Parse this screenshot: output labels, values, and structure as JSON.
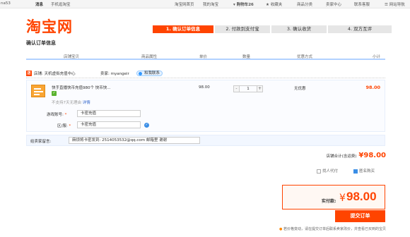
{
  "topbar": {
    "user": "na53",
    "messages": "消息",
    "mobile": "手机逛淘宝",
    "home": "淘宝网首页",
    "my_taobao": "我的淘宝",
    "cart": "购物车",
    "cart_count": "26",
    "favorites": "收藏夹",
    "categories": "商品分类",
    "seller_center": "卖家中心",
    "support": "联系客服",
    "sitemap": "网站导航"
  },
  "logo": "淘宝网",
  "page_title": "确认订单信息",
  "steps": [
    "1. 确认订单信息",
    "2. 付款到支付宝",
    "3. 确认收货",
    "4. 双方互评"
  ],
  "columns": [
    "店铺宝贝",
    "商品属性",
    "单价",
    "数量",
    "优惠方式",
    "小计"
  ],
  "shop": {
    "label": "店铺: 天机虚拟充值中心",
    "seller_label": "卖家: myangeir",
    "contact": "和我联系"
  },
  "item": {
    "title": "快手直播快币充值980个 快币快...",
    "no_refund": "不支持7天无理由",
    "details_link": "详情",
    "price": "98.00",
    "quantity": "1",
    "minus": "-",
    "plus": "+",
    "promo": "无优惠",
    "subtotal": "98.00"
  },
  "fields": {
    "game_account_label": "游戏账号:",
    "game_account_value": "卡密充值",
    "region_label": "区/服:",
    "region_value": "卡密充值"
  },
  "message": {
    "label": "给卖家留言:",
    "value": "麻烦将卡密发到: 2514053532@qq.com 邮箱里 谢谢"
  },
  "store_total": {
    "label": "店铺合计(含运费)",
    "amount": "¥98.00"
  },
  "options": {
    "find_payer": "找人代付",
    "anonymous": "匿名购买"
  },
  "final": {
    "label": "实付款:",
    "currency": "¥",
    "amount": "98.00"
  },
  "submit": "提交订单",
  "notice": "若价格变动，请在提交订单后联系卖家改价，并查看已买到的宝贝"
}
